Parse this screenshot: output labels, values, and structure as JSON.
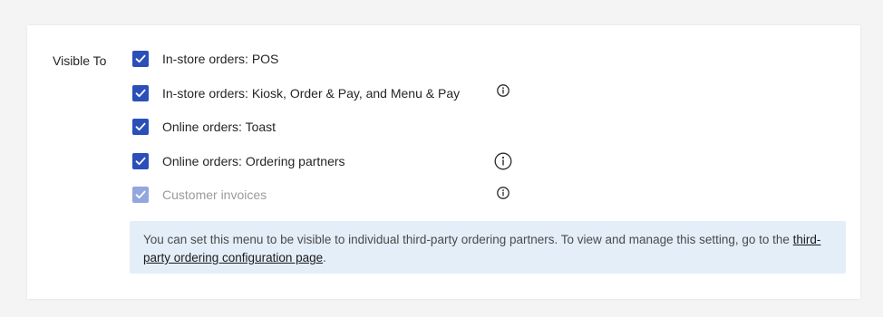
{
  "settings": {
    "visible_to_label": "Visible To",
    "options": [
      {
        "label": "In-store orders: POS",
        "checked": true,
        "disabled": false,
        "has_info": false
      },
      {
        "label": "In-store orders: Kiosk, Order & Pay, and Menu & Pay",
        "checked": true,
        "disabled": false,
        "has_info": true
      },
      {
        "label": "Online orders: Toast",
        "checked": true,
        "disabled": false,
        "has_info": false
      },
      {
        "label": "Online orders: Ordering partners",
        "checked": true,
        "disabled": false,
        "has_info": true
      },
      {
        "label": "Customer invoices",
        "checked": true,
        "disabled": true,
        "has_info": true
      }
    ]
  },
  "info_banner": {
    "text_before": "You can set this menu to be visible to individual third-party ordering partners. To view and manage this setting, go to the ",
    "link_text": "third-party ordering configuration page",
    "text_after": "."
  },
  "colors": {
    "checkbox_checked": "#2b4fb9",
    "checkbox_disabled": "#94a6de",
    "banner_background": "#e4eef9"
  },
  "icons": {
    "checkbox": "check-icon",
    "info": "info-circle-icon"
  }
}
